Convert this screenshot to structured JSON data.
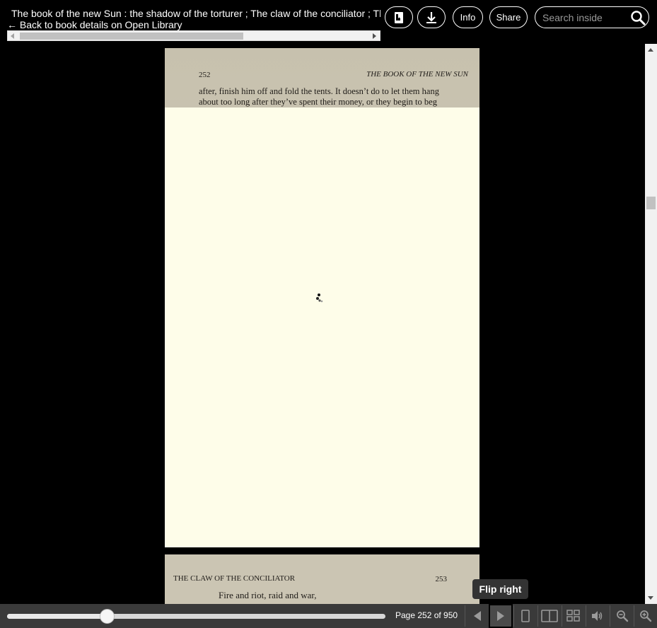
{
  "header": {
    "book_title": "The book of the new Sun : the shadow of the torturer ; The claw of the conciliator ; The sword of the lictor ; The citadel of the autarch",
    "back_link": "← Back to book details on Open Library",
    "buttons": {
      "bookmark_icon": "bookmark-page-icon",
      "download_icon": "download-icon",
      "info_label": "Info",
      "share_label": "Share"
    },
    "search": {
      "placeholder": "Search inside",
      "value": "",
      "icon": "search-icon"
    }
  },
  "pages": {
    "upper": {
      "page_number": "252",
      "running_head": "THE BOOK OF THE NEW SUN",
      "lines": [
        "after, finish him off and fold the tents. It doesn’t do to let them hang",
        "about too long after they’ve spent their money, or they begin to beg"
      ]
    },
    "lower": {
      "running_head": "THE CLAW OF THE CONCILIATOR",
      "page_number": "253",
      "lines": [
        "Fire and riot, raid and war,"
      ]
    }
  },
  "tooltip": {
    "text": "Flip right"
  },
  "navbar": {
    "progress_fraction": 0.265,
    "page_indicator": "Page 252 of 950",
    "buttons": [
      {
        "name": "flip-left-button",
        "icon": "triangle-left-icon"
      },
      {
        "name": "flip-right-button",
        "icon": "triangle-right-icon"
      },
      {
        "name": "one-page-view-button",
        "icon": "single-page-icon"
      },
      {
        "name": "two-page-view-button",
        "icon": "two-page-icon"
      },
      {
        "name": "thumbnail-view-button",
        "icon": "grid-icon"
      },
      {
        "name": "read-aloud-button",
        "icon": "speaker-icon"
      },
      {
        "name": "zoom-out-button",
        "icon": "zoom-out-icon"
      },
      {
        "name": "zoom-in-button",
        "icon": "zoom-in-icon"
      }
    ]
  },
  "colors": {
    "background": "#000000",
    "navbar": "#3a3a3a",
    "page_scan": "#cdc7b5",
    "page_loading": "#fefde9"
  }
}
